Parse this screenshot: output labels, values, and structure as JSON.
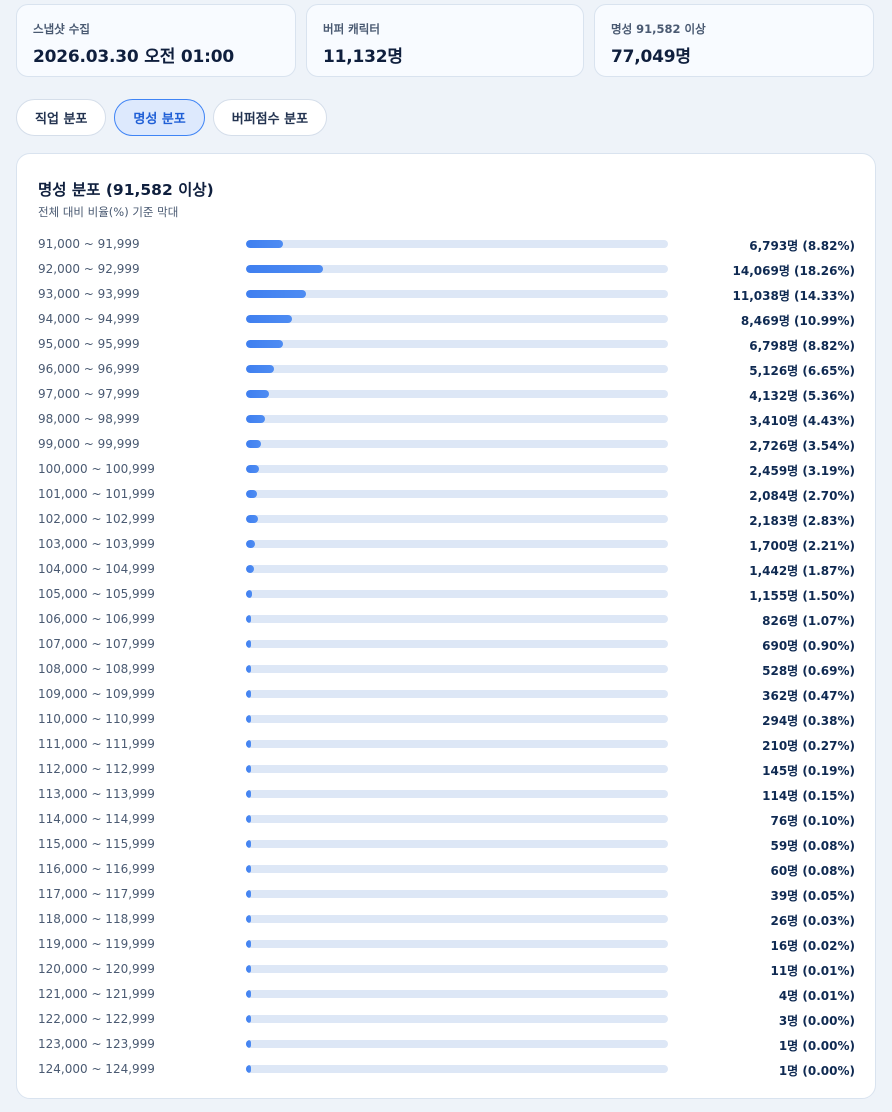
{
  "stats": [
    {
      "label": "스냅샷 수집",
      "value": "2026.03.30 오전 01:00"
    },
    {
      "label": "버퍼 캐릭터",
      "value": "11,132명"
    },
    {
      "label": "명성 91,582 이상",
      "value": "77,049명"
    }
  ],
  "tabs": [
    {
      "label": "직업 분포",
      "active": false
    },
    {
      "label": "명성 분포",
      "active": true
    },
    {
      "label": "버퍼점수 분포",
      "active": false
    }
  ],
  "panel": {
    "title": "명성 분포 (91,582 이상)",
    "subtitle": "전체 대비 비율(%) 기준 막대"
  },
  "chart_data": {
    "type": "bar",
    "title": "명성 분포 (91,582 이상)",
    "categories": [
      "91,000 ~ 91,999",
      "92,000 ~ 92,999",
      "93,000 ~ 93,999",
      "94,000 ~ 94,999",
      "95,000 ~ 95,999",
      "96,000 ~ 96,999",
      "97,000 ~ 97,999",
      "98,000 ~ 98,999",
      "99,000 ~ 99,999",
      "100,000 ~ 100,999",
      "101,000 ~ 101,999",
      "102,000 ~ 102,999",
      "103,000 ~ 103,999",
      "104,000 ~ 104,999",
      "105,000 ~ 105,999",
      "106,000 ~ 106,999",
      "107,000 ~ 107,999",
      "108,000 ~ 108,999",
      "109,000 ~ 109,999",
      "110,000 ~ 110,999",
      "111,000 ~ 111,999",
      "112,000 ~ 112,999",
      "113,000 ~ 113,999",
      "114,000 ~ 114,999",
      "115,000 ~ 115,999",
      "116,000 ~ 116,999",
      "117,000 ~ 117,999",
      "118,000 ~ 118,999",
      "119,000 ~ 119,999",
      "120,000 ~ 120,999",
      "121,000 ~ 121,999",
      "122,000 ~ 122,999",
      "123,000 ~ 123,999",
      "124,000 ~ 124,999"
    ],
    "percent": [
      8.82,
      18.26,
      14.33,
      10.99,
      8.82,
      6.65,
      5.36,
      4.43,
      3.54,
      3.19,
      2.7,
      2.83,
      2.21,
      1.87,
      1.5,
      1.07,
      0.9,
      0.69,
      0.47,
      0.38,
      0.27,
      0.19,
      0.15,
      0.1,
      0.08,
      0.08,
      0.05,
      0.03,
      0.02,
      0.01,
      0.01,
      0.0,
      0.0,
      0.0
    ],
    "value_labels": [
      "6,793명 (8.82%)",
      "14,069명 (18.26%)",
      "11,038명 (14.33%)",
      "8,469명 (10.99%)",
      "6,798명 (8.82%)",
      "5,126명 (6.65%)",
      "4,132명 (5.36%)",
      "3,410명 (4.43%)",
      "2,726명 (3.54%)",
      "2,459명 (3.19%)",
      "2,084명 (2.70%)",
      "2,183명 (2.83%)",
      "1,700명 (2.21%)",
      "1,442명 (1.87%)",
      "1,155명 (1.50%)",
      "826명 (1.07%)",
      "690명 (0.90%)",
      "528명 (0.69%)",
      "362명 (0.47%)",
      "294명 (0.38%)",
      "210명 (0.27%)",
      "145명 (0.19%)",
      "114명 (0.15%)",
      "76명 (0.10%)",
      "59명 (0.08%)",
      "60명 (0.08%)",
      "39명 (0.05%)",
      "26명 (0.03%)",
      "16명 (0.02%)",
      "11명 (0.01%)",
      "4명 (0.01%)",
      "3명 (0.00%)",
      "1명 (0.00%)",
      "1명 (0.00%)"
    ],
    "xlim": [
      0,
      100
    ],
    "accent_color": "#3f7ff0",
    "track_color": "#dde7f6"
  }
}
